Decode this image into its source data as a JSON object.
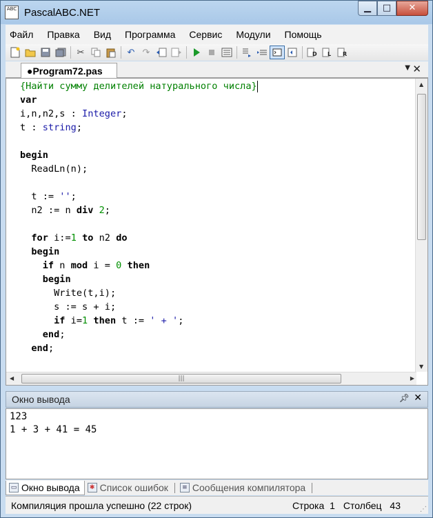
{
  "window": {
    "title": "PascalABC.NET",
    "app_icon_text": "ABC"
  },
  "menu": [
    "Файл",
    "Правка",
    "Вид",
    "Программа",
    "Сервис",
    "Модули",
    "Помощь"
  ],
  "editor": {
    "tab_label": "●Program72.pas",
    "code": [
      [
        {
          "t": "{Найти сумму делителей натурального числа}",
          "c": "cmt"
        }
      ],
      [
        {
          "t": "var",
          "c": "kw"
        }
      ],
      [
        {
          "t": "i,n,n2,s : ",
          "c": ""
        },
        {
          "t": "Integer",
          "c": "tp"
        },
        {
          "t": ";",
          "c": ""
        }
      ],
      [
        {
          "t": "t : ",
          "c": ""
        },
        {
          "t": "string",
          "c": "tp"
        },
        {
          "t": ";",
          "c": ""
        }
      ],
      [],
      [
        {
          "t": "begin",
          "c": "kw"
        }
      ],
      [
        {
          "t": "  ReadLn(n);",
          "c": ""
        }
      ],
      [],
      [
        {
          "t": "  t := ",
          "c": ""
        },
        {
          "t": "''",
          "c": "str"
        },
        {
          "t": ";",
          "c": ""
        }
      ],
      [
        {
          "t": "  n2 := n ",
          "c": ""
        },
        {
          "t": "div",
          "c": "kw"
        },
        {
          "t": " ",
          "c": ""
        },
        {
          "t": "2",
          "c": "num"
        },
        {
          "t": ";",
          "c": ""
        }
      ],
      [],
      [
        {
          "t": "  ",
          "c": ""
        },
        {
          "t": "for",
          "c": "kw"
        },
        {
          "t": " i:=",
          "c": ""
        },
        {
          "t": "1",
          "c": "num"
        },
        {
          "t": " ",
          "c": ""
        },
        {
          "t": "to",
          "c": "kw"
        },
        {
          "t": " n2 ",
          "c": ""
        },
        {
          "t": "do",
          "c": "kw"
        }
      ],
      [
        {
          "t": "  ",
          "c": ""
        },
        {
          "t": "begin",
          "c": "kw"
        }
      ],
      [
        {
          "t": "    ",
          "c": ""
        },
        {
          "t": "if",
          "c": "kw"
        },
        {
          "t": " n ",
          "c": ""
        },
        {
          "t": "mod",
          "c": "kw"
        },
        {
          "t": " i = ",
          "c": ""
        },
        {
          "t": "0",
          "c": "num"
        },
        {
          "t": " ",
          "c": ""
        },
        {
          "t": "then",
          "c": "kw"
        }
      ],
      [
        {
          "t": "    ",
          "c": ""
        },
        {
          "t": "begin",
          "c": "kw"
        }
      ],
      [
        {
          "t": "      Write(t,i);",
          "c": ""
        }
      ],
      [
        {
          "t": "      s := s + i;",
          "c": ""
        }
      ],
      [
        {
          "t": "      ",
          "c": ""
        },
        {
          "t": "if",
          "c": "kw"
        },
        {
          "t": " i=",
          "c": ""
        },
        {
          "t": "1",
          "c": "num"
        },
        {
          "t": " ",
          "c": ""
        },
        {
          "t": "then",
          "c": "kw"
        },
        {
          "t": " t := ",
          "c": ""
        },
        {
          "t": "' + '",
          "c": "str"
        },
        {
          "t": ";",
          "c": ""
        }
      ],
      [
        {
          "t": "    ",
          "c": ""
        },
        {
          "t": "end",
          "c": "kw"
        },
        {
          "t": ";",
          "c": ""
        }
      ],
      [
        {
          "t": "  ",
          "c": ""
        },
        {
          "t": "end",
          "c": "kw"
        },
        {
          "t": ";",
          "c": ""
        }
      ]
    ]
  },
  "output": {
    "title": "Окно вывода",
    "lines": [
      "123",
      "1 + 3 + 41 = 45"
    ]
  },
  "bottom_tabs": [
    "Окно вывода",
    "Список ошибок",
    "Сообщения компилятора"
  ],
  "status": {
    "message": "Компиляция прошла успешно (22 строк)",
    "row_label": "Строка",
    "row_value": "1",
    "col_label": "Столбец",
    "col_value": "43"
  }
}
